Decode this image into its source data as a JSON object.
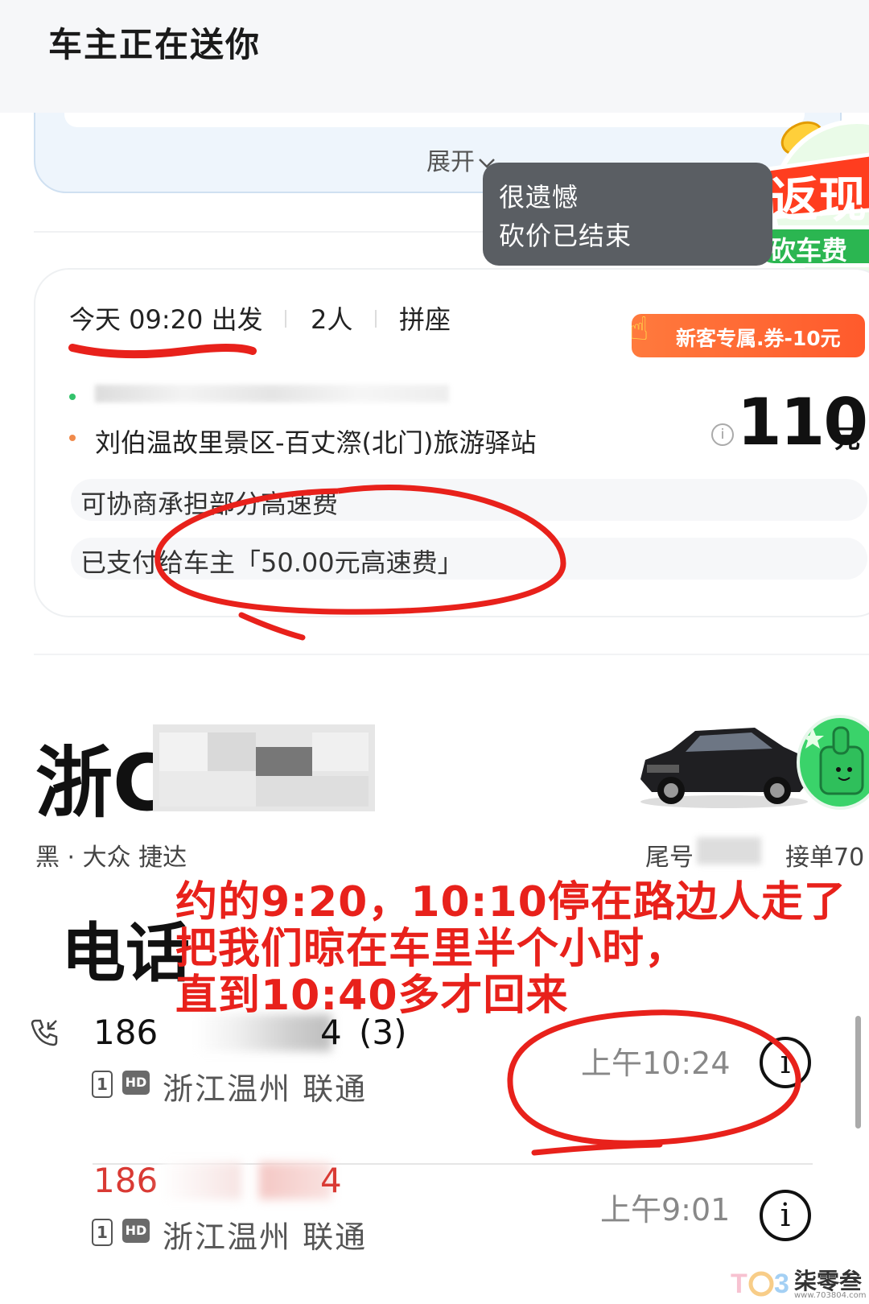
{
  "header": {
    "title": "车主正在送你"
  },
  "collapsed_card": {
    "expand_label": "展开"
  },
  "toast": {
    "line1": "很遗憾",
    "line2": "砍价已结束"
  },
  "promo_badge": {
    "top_text": "返现",
    "bottom_text": "砍车费"
  },
  "trip": {
    "departure": "今天 09:20 出发",
    "passengers": "2人",
    "mode": "拼座",
    "coupon": "新客专属.券-10元",
    "destination": "刘伯温故里景区-百丈漈(北门)旅游驿站",
    "price": "110",
    "price_unit": "元",
    "note_toll_negotiable": "可协商承担部分高速费",
    "note_toll_paid": "已支付给车主「50.00元高速费」"
  },
  "driver": {
    "plate_prefix": "浙C",
    "car_desc": "黑 · 大众 捷达",
    "tail_label": "尾号",
    "orders_label": "接单70"
  },
  "annotation": {
    "line1": "约的9:20，10:10停在路边人走了",
    "line2": "把我们晾在车里半个小时，",
    "line3": "直到10:40多才回来"
  },
  "phone_section": {
    "title": "电话"
  },
  "calls": [
    {
      "number_start": "186",
      "number_end": "4",
      "count": "(3)",
      "sim": "1",
      "hd": "HD",
      "location": "浙江温州 联通",
      "time": "上午10:24"
    },
    {
      "number_start": "186",
      "number_end": "4",
      "count": "",
      "sim": "1",
      "hd": "HD",
      "location": "浙江温州 联通",
      "time": "上午9:01"
    }
  ],
  "watermark": {
    "brand": "柒零叁",
    "url": "www.703804.com"
  },
  "colors": {
    "annotation_red": "#e8211b",
    "coupon_orange": "#ff5a2c",
    "missed_call_red": "#d93a34"
  }
}
